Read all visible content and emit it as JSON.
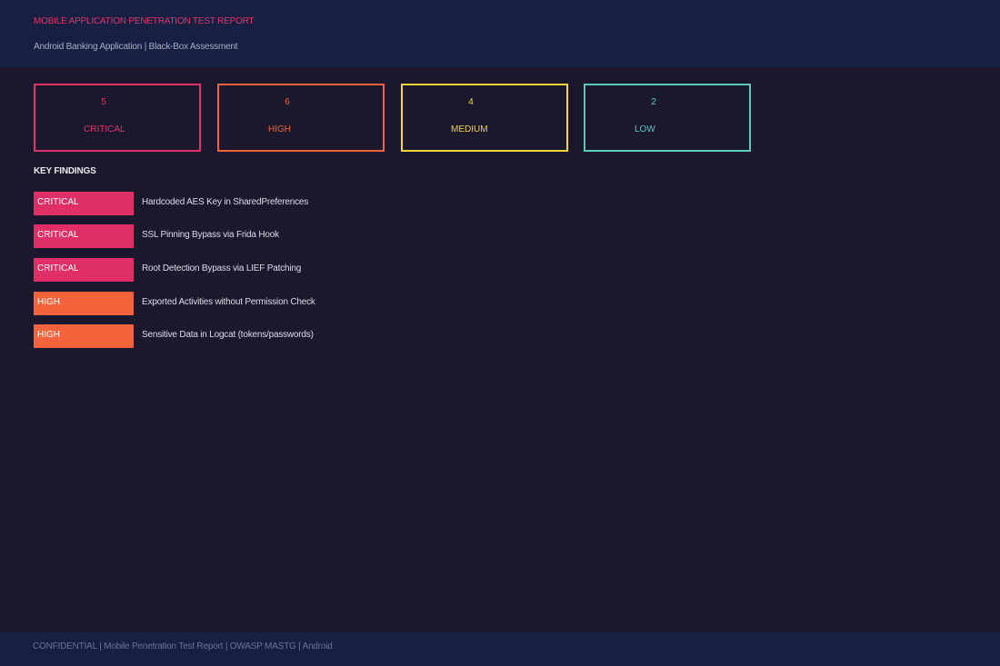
{
  "header": {
    "title": "MOBILE APPLICATION PENETRATION TEST REPORT",
    "subtitle": "Android Banking Application | Black-Box Assessment"
  },
  "summary": [
    {
      "count": "5",
      "label": "CRITICAL",
      "color": "#e0336a"
    },
    {
      "count": "6",
      "label": "HIGH",
      "color": "#f0643c"
    },
    {
      "count": "4",
      "label": "MEDIUM",
      "color": "#f6d43a"
    },
    {
      "count": "2",
      "label": "LOW",
      "color": "#5ec8b9"
    }
  ],
  "findings_section": {
    "heading": "KEY FINDINGS"
  },
  "findings": [
    {
      "severity": "CRITICAL",
      "title": "Hardcoded AES Key in SharedPreferences",
      "color": "#df2f66"
    },
    {
      "severity": "CRITICAL",
      "title": "SSL Pinning Bypass via Frida Hook",
      "color": "#df2f66"
    },
    {
      "severity": "CRITICAL",
      "title": "Root Detection Bypass via LIEF Patching",
      "color": "#df2f66"
    },
    {
      "severity": "HIGH",
      "title": "Exported Activities without Permission Check",
      "color": "#f5633d"
    },
    {
      "severity": "HIGH",
      "title": "Sensitive Data in Logcat (tokens/passwords)",
      "color": "#f5633d"
    }
  ],
  "footer": {
    "text": "CONFIDENTIAL | Mobile Penetration Test Report | OWASP MASTG | Android"
  }
}
